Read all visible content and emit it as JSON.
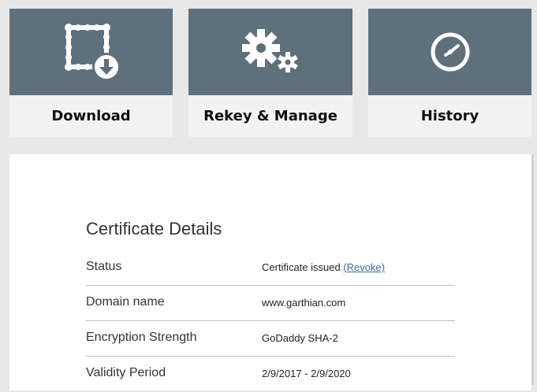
{
  "actions": [
    {
      "label": "Download",
      "icon": "certificate-download-icon"
    },
    {
      "label": "Rekey & Manage",
      "icon": "gears-icon"
    },
    {
      "label": "History",
      "icon": "clock-icon"
    }
  ],
  "details": {
    "title": "Certificate Details",
    "rows": [
      {
        "label": "Status",
        "value": "Certificate issued",
        "link": "(Revoke)"
      },
      {
        "label": "Domain name",
        "value": "www.garthian.com"
      },
      {
        "label": "Encryption Strength",
        "value": "GoDaddy SHA-2"
      },
      {
        "label": "Validity Period",
        "value": "2/9/2017 - 2/9/2020"
      }
    ]
  },
  "colors": {
    "tile": "#5f707d",
    "tile_label_bg": "#f2f2f2",
    "background": "#e8e8e8",
    "link": "#3a6b9b"
  }
}
